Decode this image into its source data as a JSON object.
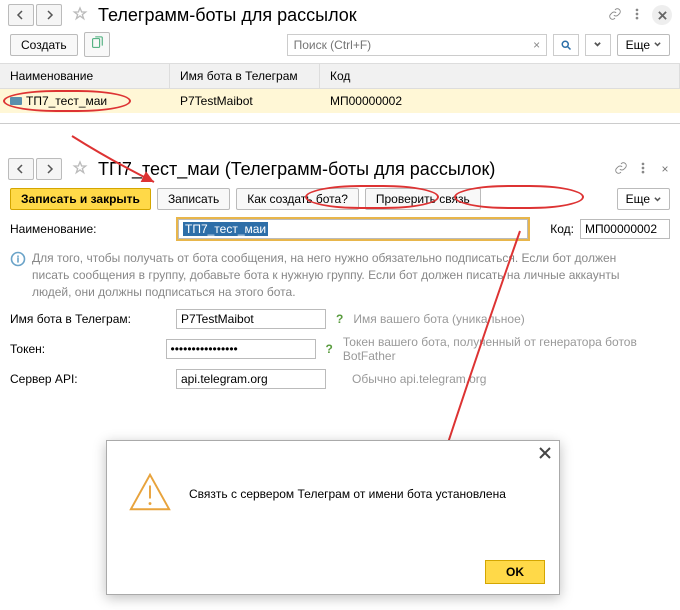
{
  "top": {
    "title": "Телеграмм-боты для рассылок",
    "create_label": "Создать",
    "search_placeholder": "Поиск (Ctrl+F)",
    "more_label": "Еще",
    "columns": {
      "name": "Наименование",
      "bot": "Имя бота в Телеграм",
      "code": "Код"
    },
    "row": {
      "name": "ТП7_тест_маи",
      "bot": "P7TestMaibot",
      "code": "МП00000002"
    }
  },
  "bot": {
    "title": "ТП7_тест_маи (Телеграмм-боты для рассылок)",
    "save_close": "Записать и закрыть",
    "save": "Записать",
    "howto": "Как создать бота?",
    "check": "Проверить связь",
    "more": "Еще",
    "name_label": "Наименование:",
    "name_value": "ТП7_тест_маи",
    "code_label": "Код:",
    "code_value": "МП00000002",
    "info": "Для того, чтобы получать от бота сообщения, на него нужно обязательно подписаться. Если бот должен писать сообщения в группу, добавьте бота к нужную группу. Если бот должен писать на личные аккаунты людей, они должны подписаться на этого бота.",
    "botname_label": "Имя бота в Телеграм:",
    "botname_value": "P7TestMaibot",
    "botname_hint": "Имя вашего бота (уникальное)",
    "token_label": "Токен:",
    "token_value": "••••••••••••••••",
    "token_hint": "Токен вашего бота, полученный от генератора ботов BotFather",
    "server_label": "Сервер API:",
    "server_value": "api.telegram.org",
    "server_hint": "Обычно api.telegram.org"
  },
  "dialog": {
    "text": "Связть с сервером Телеграм от имени бота установлена",
    "ok": "OK"
  }
}
